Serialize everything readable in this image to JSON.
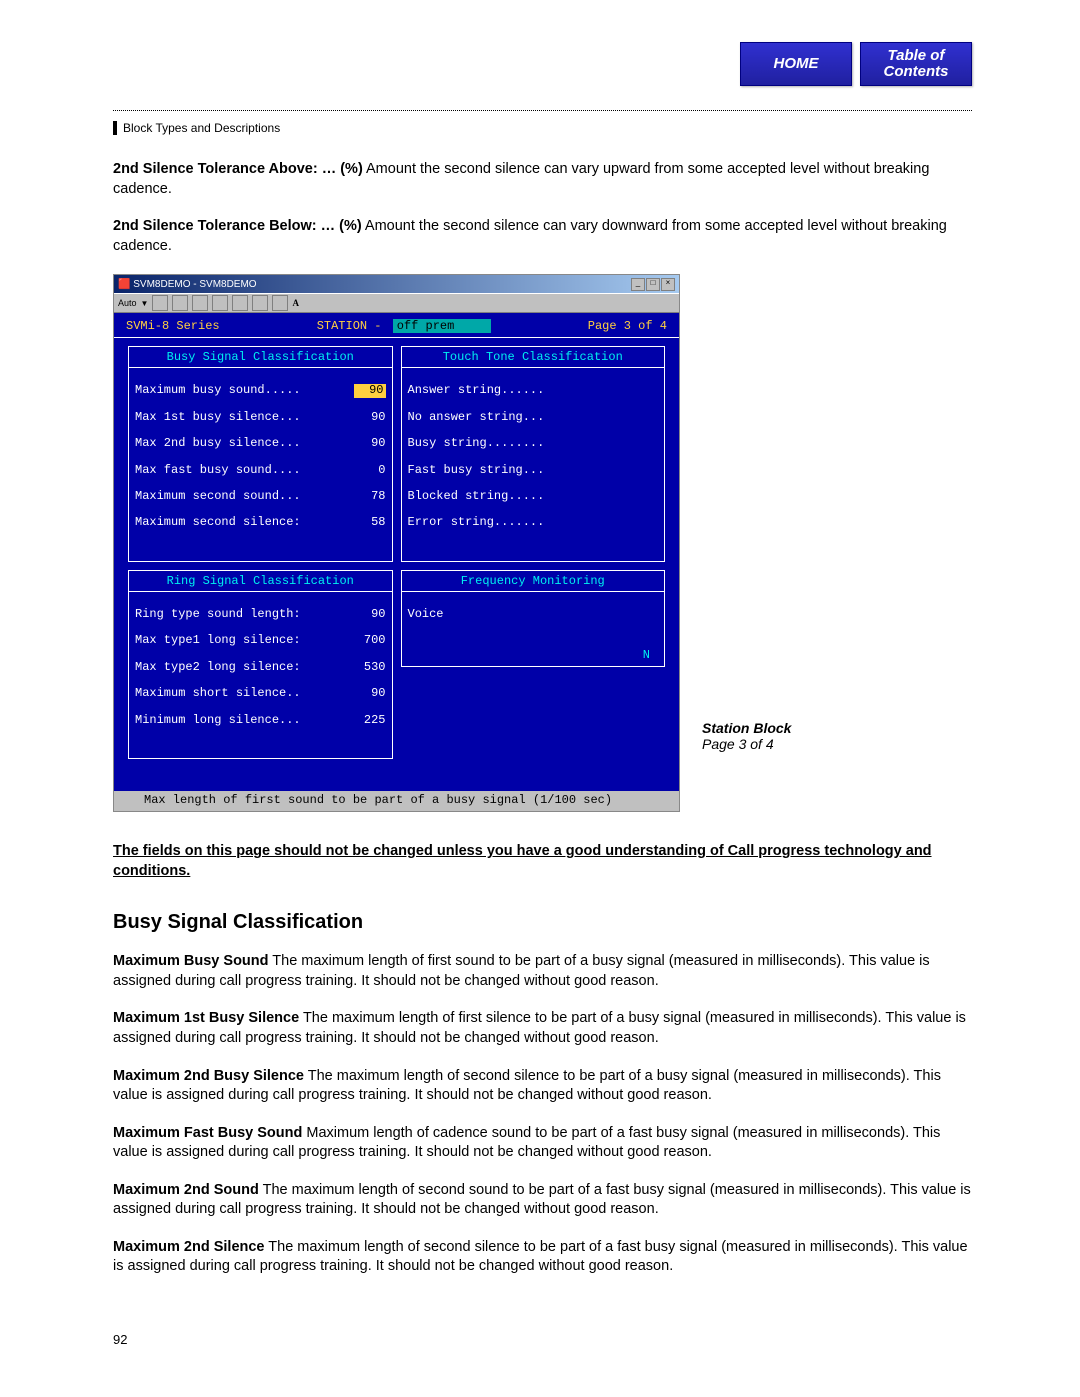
{
  "nav": {
    "home": "HOME",
    "toc": "Table of\nContents"
  },
  "sectionTag": "Block Types and Descriptions",
  "intro": [
    {
      "term": "2nd Silence Tolerance Above: … (%)",
      "text": "   Amount the second silence can vary upward from some accepted level without breaking cadence."
    },
    {
      "term": "2nd Silence Tolerance Below: … (%)",
      "text": "   Amount the second silence can vary downward from some accepted level without breaking cadence."
    }
  ],
  "shot": {
    "title": "SVM8DEMO - SVM8DEMO",
    "auto": "Auto",
    "hdr": {
      "series": "SVMi-8 Series",
      "stationLabel": "STATION -",
      "stationValue": "off prem",
      "page": "Page 3 of 4"
    },
    "boxes": {
      "busyTitle": "Busy Signal Classification",
      "busy": [
        {
          "label": "Maximum busy sound.....",
          "value": "90",
          "hl": true
        },
        {
          "label": "Max 1st busy silence...",
          "value": "90"
        },
        {
          "label": "Max 2nd busy silence...",
          "value": "90"
        },
        {
          "label": "Max fast busy sound....",
          "value": "0"
        },
        {
          "label": "Maximum second sound...",
          "value": "78"
        },
        {
          "label": "Maximum second silence:",
          "value": "58"
        }
      ],
      "ringTitle": "Ring Signal Classification",
      "ring": [
        {
          "label": "Ring type sound length:",
          "value": "90"
        },
        {
          "label": "Max type1 long silence:",
          "value": "700"
        },
        {
          "label": "Max type2 long silence:",
          "value": "530"
        },
        {
          "label": "Maximum short silence..",
          "value": "90"
        },
        {
          "label": "Minimum long silence...",
          "value": "225"
        }
      ],
      "touchTitle": "Touch Tone Classification",
      "touch": [
        "Answer string......",
        "No answer string...",
        "Busy string........",
        "Fast busy string...",
        "Blocked string.....",
        "Error string......."
      ],
      "freqTitle": "Frequency Monitoring",
      "freqBody": "Voice",
      "freqFlag": "N"
    },
    "status": "Max length of first sound to be part of a busy signal (1/100 sec)"
  },
  "caption": {
    "title": "Station Block",
    "sub": "Page 3 of 4"
  },
  "warning": "The fields on this page should not be changed unless you have a good understanding of Call progress technology and conditions.",
  "sectionHeading": "Busy Signal Classification",
  "defs": [
    {
      "term": "Maximum Busy Sound",
      "text": "   The maximum length of first sound to be part of a busy signal (measured in milliseconds). This value is assigned during call progress training. It should not be changed without good reason."
    },
    {
      "term": "Maximum 1st Busy Silence",
      "text": "   The maximum length of first silence to be part of a busy signal (measured in milliseconds). This value is assigned during call progress training. It should not be changed without good reason."
    },
    {
      "term": "Maximum 2nd Busy Silence",
      "text": "   The maximum length of second silence to be part of a busy signal (measured in milliseconds). This value is assigned during call progress training. It should not be changed without good reason."
    },
    {
      "term": "Maximum Fast Busy Sound",
      "text": "   Maximum length of cadence sound to be part of a fast busy signal (measured in milliseconds). This value is assigned during call progress training. It should not be changed without good reason."
    },
    {
      "term": "Maximum 2nd Sound",
      "text": "   The maximum length of second sound to be part of a fast busy signal (measured in milliseconds). This value is assigned during call progress training. It should not be changed without good reason."
    },
    {
      "term": "Maximum 2nd Silence",
      "text": "   The maximum length of second silence to be part of a fast busy signal (measured in milliseconds). This value is assigned during call progress training. It should not be changed without good reason."
    }
  ],
  "pageNumber": "92"
}
